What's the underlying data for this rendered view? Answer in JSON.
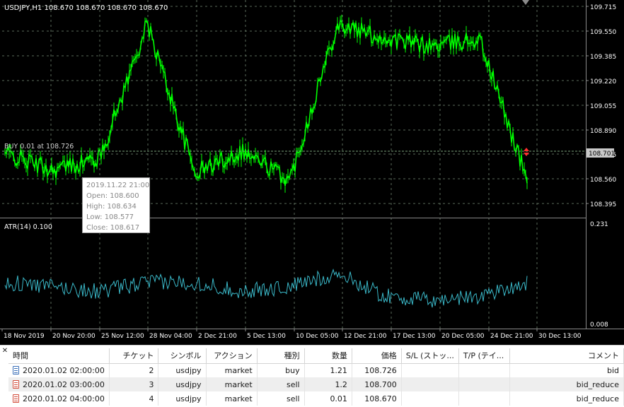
{
  "chart": {
    "title": "USDJPY,H1  108.670 108.670 108.670 108.670",
    "price_ticks": [
      "109.715",
      "109.550",
      "109.385",
      "109.220",
      "109.055",
      "108.890",
      "108.725",
      "108.560",
      "108.395"
    ],
    "current_price": "108.701",
    "order_label": "BUY 0.01 at 108.726",
    "indicator_label": "ATR(14) 0.100",
    "indicator_ticks": [
      "0.231",
      "0.008"
    ],
    "date_ticks": [
      "18 Nov 2019",
      "20 Nov 20:00",
      "25 Nov 12:00",
      "28 Nov 04:00",
      "2 Dec 21:00",
      "5 Dec 13:00",
      "10 Dec 05:00",
      "12 Dec 21:00",
      "17 Dec 13:00",
      "20 Dec 05:00",
      "24 Dec 21:00",
      "30 Dec 13:00"
    ],
    "colors": {
      "background": "#000000",
      "candles": "#00ff00",
      "atr_line": "#3ab8c8",
      "grid": "#5a6a5a",
      "axis_text": "#ffffff"
    }
  },
  "chart_data": {
    "type": "line",
    "title": "USDJPY,H1",
    "ylim": [
      108.3,
      109.76
    ],
    "x": [
      "18 Nov 2019",
      "20 Nov 20:00",
      "25 Nov 12:00",
      "28 Nov 04:00",
      "2 Dec 21:00",
      "5 Dec 13:00",
      "10 Dec 05:00",
      "12 Dec 21:00",
      "17 Dec 13:00",
      "20 Dec 05:00",
      "24 Dec 21:00",
      "30 Dec 13:00"
    ],
    "series": [
      {
        "name": "USDJPY,H1",
        "values": [
          108.73,
          108.62,
          108.7,
          109.6,
          108.6,
          108.75,
          108.55,
          109.6,
          109.5,
          109.45,
          109.5,
          108.55
        ]
      },
      {
        "name": "ATR(14)",
        "values": [
          0.1,
          0.09,
          0.08,
          0.1,
          0.1,
          0.08,
          0.09,
          0.12,
          0.07,
          0.06,
          0.07,
          0.1
        ],
        "ylim": [
          0.008,
          0.231
        ]
      }
    ],
    "annotations": [
      "BUY 0.01 at 108.726"
    ]
  },
  "tooltip": {
    "time": "2019.11.22 21:00",
    "open": "Open: 108.600",
    "high": "High: 108.634",
    "low": "Low: 108.577",
    "close": "Close: 108.617"
  },
  "table": {
    "headers": [
      "時間",
      "チケット",
      "シンボル",
      "アクション",
      "種別",
      "数量",
      "価格",
      "S/L (ストッ...",
      "T/P (テイ...",
      "コメント"
    ],
    "rows": [
      {
        "time": "2020.01.02 02:00:00",
        "ticket": "2",
        "symbol": "usdjpy",
        "action": "market",
        "type": "buy",
        "volume": "1.21",
        "price": "108.726",
        "sl": "",
        "tp": "",
        "comment": "bid"
      },
      {
        "time": "2020.01.02 03:00:00",
        "ticket": "3",
        "symbol": "usdjpy",
        "action": "market",
        "type": "sell",
        "volume": "1.2",
        "price": "108.700",
        "sl": "",
        "tp": "",
        "comment": "bid_reduce"
      },
      {
        "time": "2020.01.02 04:00:00",
        "ticket": "4",
        "symbol": "usdjpy",
        "action": "market",
        "type": "sell",
        "volume": "0.01",
        "price": "108.670",
        "sl": "",
        "tp": "",
        "comment": "bid_reduce"
      }
    ]
  }
}
